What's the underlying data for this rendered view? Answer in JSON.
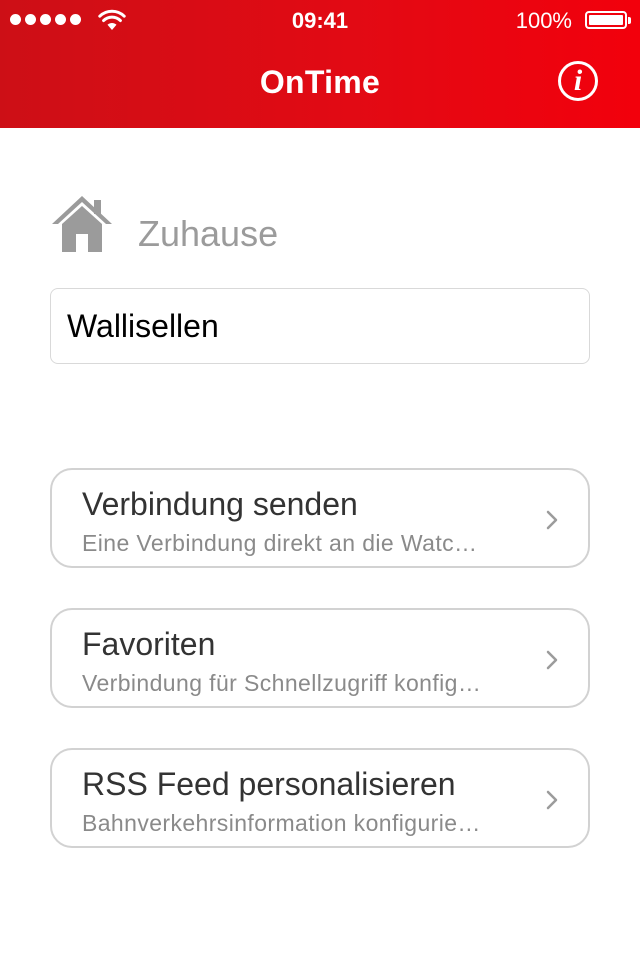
{
  "status_bar": {
    "time": "09:41",
    "battery_percent": "100%",
    "battery_level": 1.0,
    "signal_bars": 5
  },
  "nav": {
    "title": "OnTime",
    "info_glyph": "i"
  },
  "home": {
    "label": "Zuhause",
    "icon": "home-icon",
    "station_value": "Wallisellen"
  },
  "menu": [
    {
      "title": "Verbindung senden",
      "subtitle": "Eine Verbindung direkt an die Watc…",
      "icon": "chevron-right-icon"
    },
    {
      "title": "Favoriten",
      "subtitle": "Verbindung für Schnellzugriff konfig…",
      "icon": "chevron-right-icon"
    },
    {
      "title": "RSS Feed personalisieren",
      "subtitle": "Bahnverkehrsinformation konfigurie…",
      "icon": "chevron-right-icon"
    }
  ],
  "colors": {
    "accent": "#e20a14",
    "header_start": "#cd0f16",
    "header_end": "#f2000c",
    "muted_text": "#9b9b9b",
    "card_border": "#d2d2d2"
  }
}
